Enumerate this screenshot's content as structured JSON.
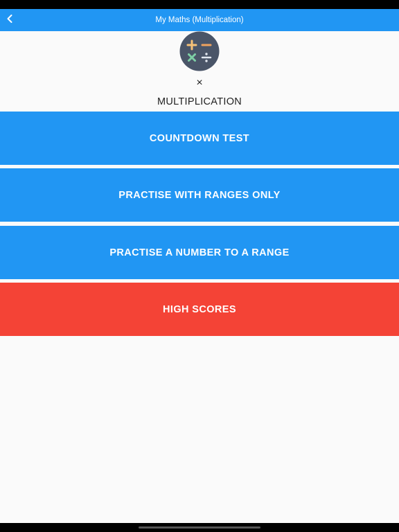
{
  "app_bar": {
    "title": "My Maths (Multiplication)",
    "back_icon": "chevron-left-icon",
    "color": "#2196f3"
  },
  "logo": {
    "icon": "calculator-operations-icon",
    "background": "#4a5568",
    "plus_color": "#f6c177",
    "minus_color": "#f0a35e",
    "times_color": "#7ecfa5",
    "divide_color": "#e2e8f0"
  },
  "operation_symbol": "×",
  "section_title": "MULTIPLICATION",
  "buttons": {
    "countdown_test": "COUNTDOWN TEST",
    "practise_ranges": "PRACTISE WITH RANGES ONLY",
    "practise_number": "PRACTISE A NUMBER TO A RANGE",
    "high_scores": "HIGH SCORES"
  },
  "colors": {
    "primary_button": "#2196f3",
    "high_scores_button": "#f44336"
  }
}
